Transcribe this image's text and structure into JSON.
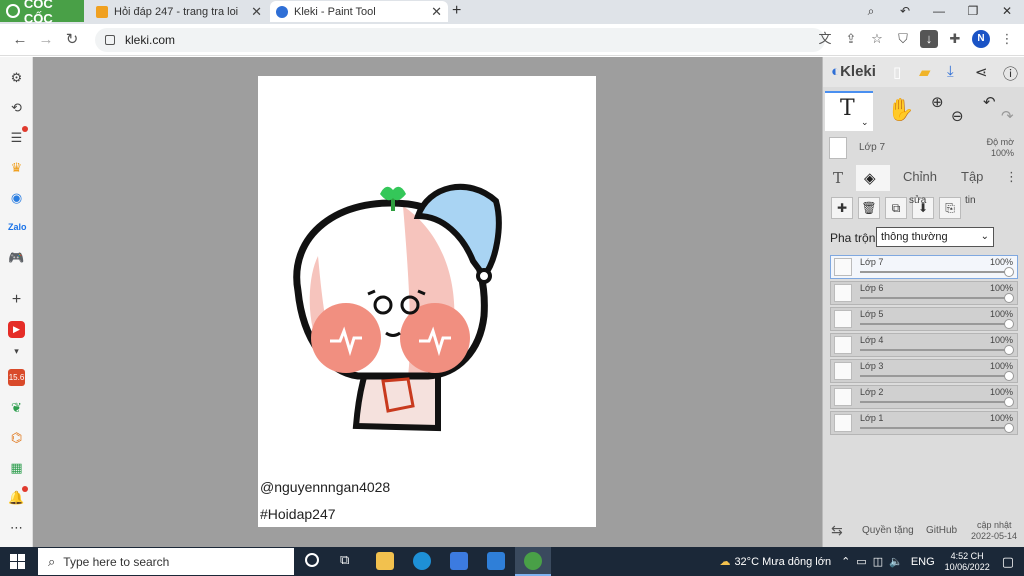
{
  "browser": {
    "brand": "CỐC CỐC",
    "tabs": [
      {
        "title": "Hỏi đáp 247 - trang tra loi",
        "active": false
      },
      {
        "title": "Kleki - Paint Tool",
        "active": true
      }
    ],
    "url": "kleki.com",
    "profile_initial": "N"
  },
  "canvas": {
    "signature_line1": "@nguyennngan4028",
    "signature_line2": "#Hoidap247"
  },
  "kleki": {
    "logo_text": "Kleki",
    "current_layer_name": "Lớp 7",
    "opacity_label": "Độ mờ",
    "opacity_value": "100%",
    "tab_edit": "Chỉnh",
    "tab_file": "Tập",
    "merge_label": "sửa",
    "info_label": "tin",
    "blend_label": "Pha trộn",
    "blend_value": "thông thường",
    "layers": [
      {
        "name": "Lớp 7",
        "opacity": "100%",
        "active": true
      },
      {
        "name": "Lớp 6",
        "opacity": "100%",
        "active": false
      },
      {
        "name": "Lớp 5",
        "opacity": "100%",
        "active": false
      },
      {
        "name": "Lớp 4",
        "opacity": "100%",
        "active": false
      },
      {
        "name": "Lớp 3",
        "opacity": "100%",
        "active": false
      },
      {
        "name": "Lớp 2",
        "opacity": "100%",
        "active": false
      },
      {
        "name": "Lớp 1",
        "opacity": "100%",
        "active": false
      }
    ],
    "footer": {
      "privacy": "Quyền tặng",
      "github": "GitHub",
      "updated_label": "cập nhật",
      "updated_date": "2022-05-14"
    }
  },
  "taskbar": {
    "search_placeholder": "Type here to search",
    "weather": "32°C  Mưa dông lớn",
    "language": "ENG",
    "time": "4:52 CH",
    "date": "10/06/2022"
  }
}
